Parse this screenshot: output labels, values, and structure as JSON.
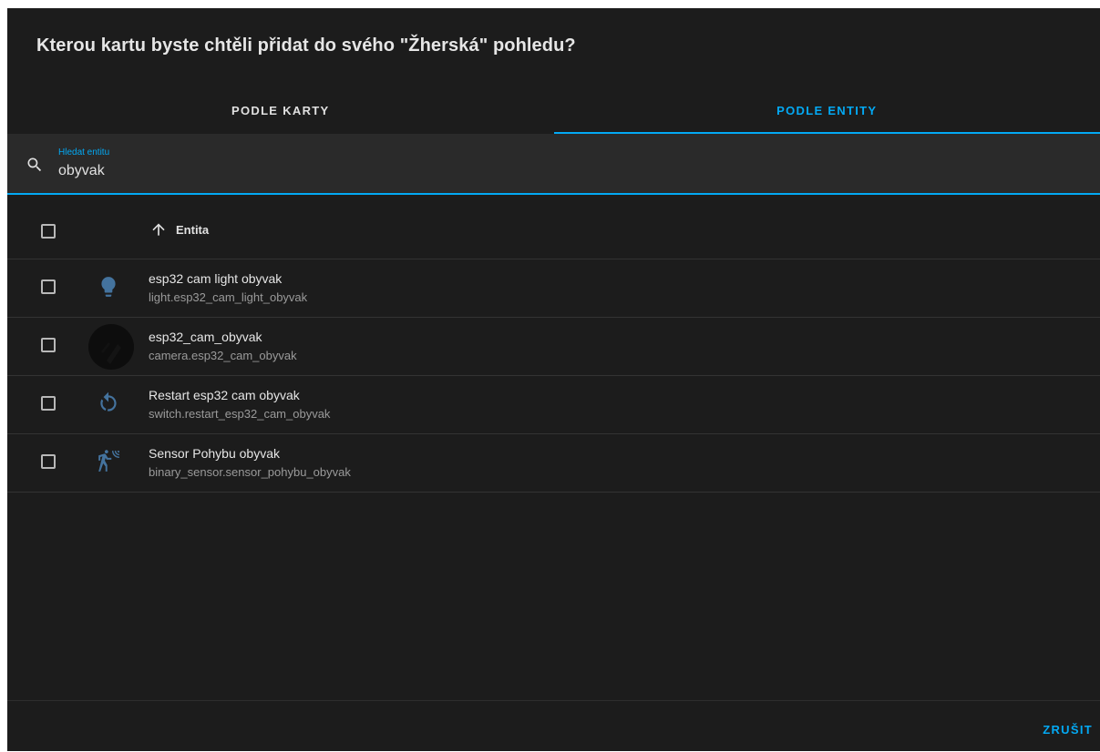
{
  "dialog": {
    "title": "Kterou kartu byste chtěli přidat do svého \"Žherská\" pohledu?"
  },
  "tabs": [
    {
      "label": "PODLE KARTY",
      "active": false
    },
    {
      "label": "PODLE ENTITY",
      "active": true
    }
  ],
  "search": {
    "label": "Hledat entitu",
    "value": "obyvak",
    "icon": "magnify-icon"
  },
  "table": {
    "column_header": "Entita",
    "sort_icon": "arrow-up-icon",
    "rows": [
      {
        "name": "esp32 cam light obyvak",
        "entity_id": "light.esp32_cam_light_obyvak",
        "icon": "lightbulb-icon"
      },
      {
        "name": "esp32_cam_obyvak",
        "entity_id": "camera.esp32_cam_obyvak",
        "icon": "camera-thumbnail"
      },
      {
        "name": "Restart esp32 cam obyvak",
        "entity_id": "switch.restart_esp32_cam_obyvak",
        "icon": "restart-icon"
      },
      {
        "name": "Sensor Pohybu obyvak",
        "entity_id": "binary_sensor.sensor_pohybu_obyvak",
        "icon": "motion-sensor-icon"
      }
    ]
  },
  "footer": {
    "cancel_label": "ZRUŠIT"
  },
  "colors": {
    "accent": "#03a9f4",
    "icon": "#44739e",
    "background": "#1c1c1c"
  }
}
